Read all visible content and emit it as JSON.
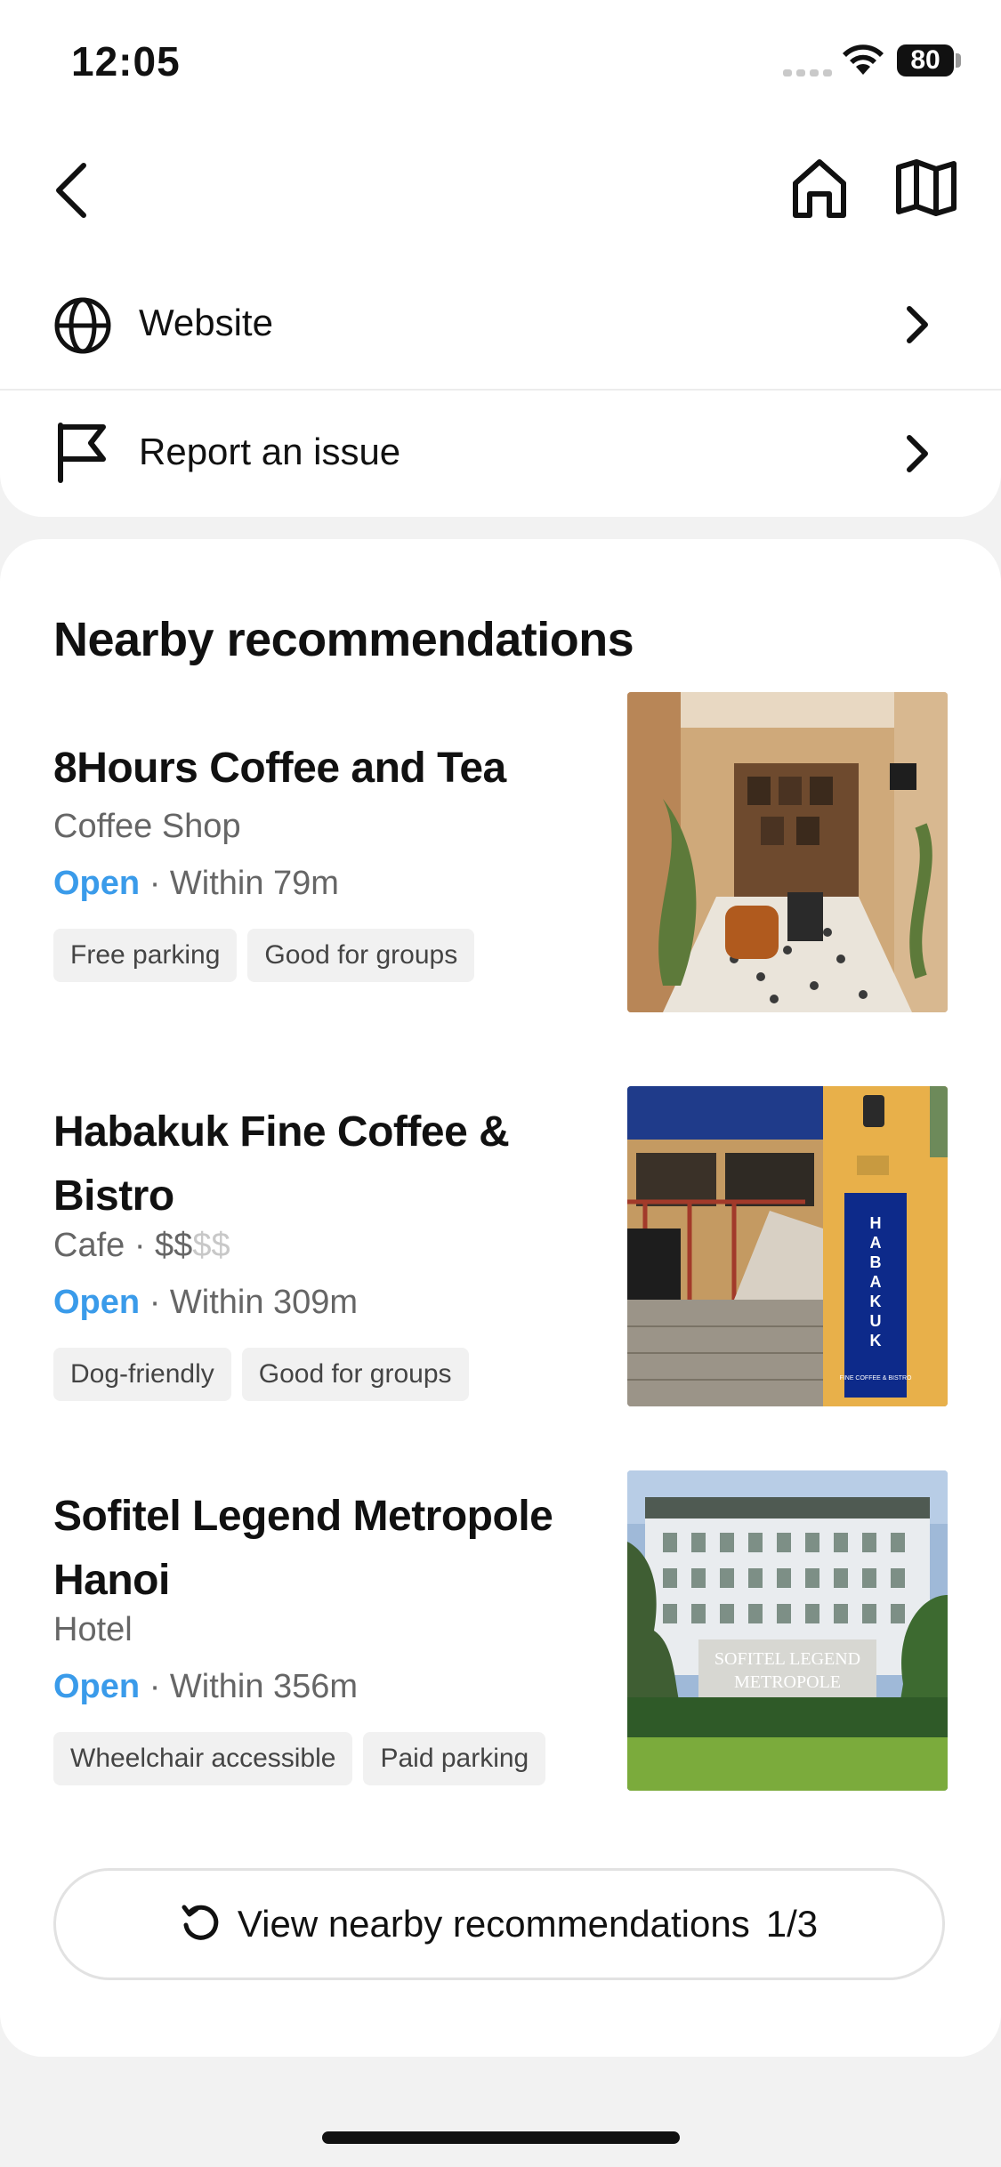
{
  "status_bar": {
    "time": "12:05",
    "battery": "80"
  },
  "nav": {
    "back_icon": "chevron-left-icon",
    "home_icon": "home-icon",
    "map_icon": "map-icon"
  },
  "links": [
    {
      "label": "Website",
      "icon": "globe-icon"
    },
    {
      "label": "Report an issue",
      "icon": "flag-icon"
    }
  ],
  "recommendations": {
    "title": "Nearby recommendations",
    "items": [
      {
        "name": "8Hours Coffee and Tea",
        "category": "Coffee Shop",
        "status": "Open",
        "distance": "· Within 79m",
        "tags": [
          "Free parking",
          "Good for groups"
        ]
      },
      {
        "name": "Habakuk Fine Coffee & Bistro",
        "category": "Cafe · ",
        "price": "$$",
        "price_dim": "$$",
        "status": "Open",
        "distance": "· Within 309m",
        "tags": [
          "Dog-friendly",
          "Good for groups"
        ],
        "image_sign_text": "HABAKUK",
        "image_sign_sub": "FINE COFFEE & BISTRO"
      },
      {
        "name": "Sofitel Legend Metropole Hanoi",
        "category": "Hotel",
        "status": "Open",
        "distance": "· Within 356m",
        "tags": [
          "Wheelchair accessible",
          "Paid parking"
        ],
        "image_sign_line1": "SOFITEL LEGEND",
        "image_sign_line2": "METROPOLE"
      }
    ],
    "more_button": {
      "label": "View nearby recommendations",
      "page": "1/3",
      "icon": "refresh-icon"
    }
  },
  "colors": {
    "accent_open": "#3a9bea",
    "page_bg": "#f2f2f2",
    "card_bg": "#ffffff",
    "tag_bg": "#f1f1f1"
  }
}
